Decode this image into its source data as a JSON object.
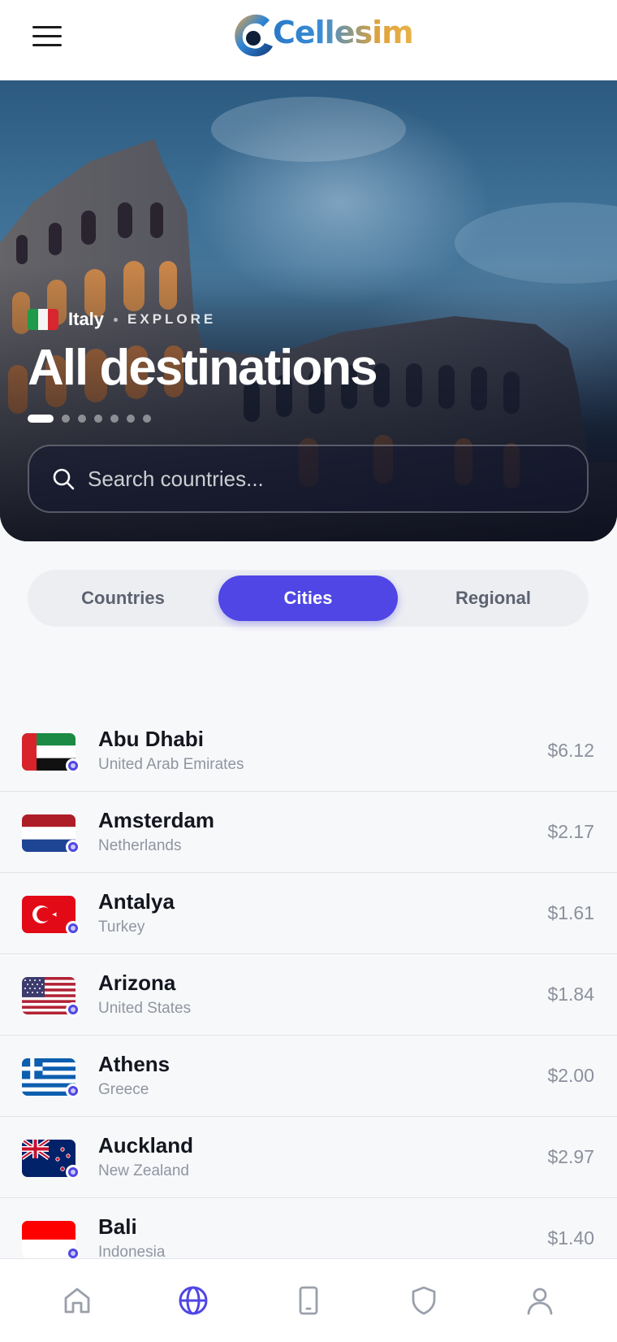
{
  "header": {
    "brand": "Cellesim",
    "menu_icon": "hamburger-menu-icon"
  },
  "hero": {
    "country": "Italy",
    "country_flag": "italy-flag",
    "eyebrow": "EXPLORE",
    "title": "All destinations",
    "slides_total": 7,
    "slide_active_index": 0,
    "background_image": "colosseum-at-dusk"
  },
  "search": {
    "placeholder": "Search countries...",
    "value": "",
    "icon": "search-icon"
  },
  "tabs": [
    {
      "label": "Countries",
      "active": false
    },
    {
      "label": "Cities",
      "active": true
    },
    {
      "label": "Regional",
      "active": false
    }
  ],
  "cities": [
    {
      "name": "Abu Dhabi",
      "country": "United Arab Emirates",
      "price": "$6.12",
      "flag": "uae-flag"
    },
    {
      "name": "Amsterdam",
      "country": "Netherlands",
      "price": "$2.17",
      "flag": "netherlands-flag"
    },
    {
      "name": "Antalya",
      "country": "Turkey",
      "price": "$1.61",
      "flag": "turkey-flag"
    },
    {
      "name": "Arizona",
      "country": "United States",
      "price": "$1.84",
      "flag": "usa-flag"
    },
    {
      "name": "Athens",
      "country": "Greece",
      "price": "$2.00",
      "flag": "greece-flag"
    },
    {
      "name": "Auckland",
      "country": "New Zealand",
      "price": "$2.97",
      "flag": "new-zealand-flag"
    },
    {
      "name": "Bali",
      "country": "Indonesia",
      "price": "$1.40",
      "flag": "indonesia-flag"
    }
  ],
  "bottom_nav": [
    {
      "icon": "home-icon",
      "active": false
    },
    {
      "icon": "globe-icon",
      "active": true
    },
    {
      "icon": "device-icon",
      "active": false
    },
    {
      "icon": "shield-icon",
      "active": false
    },
    {
      "icon": "profile-icon",
      "active": false
    }
  ],
  "colors": {
    "accent": "#4f46e5",
    "inactive_icon": "#9aa0ab",
    "text_primary": "#14161f",
    "text_secondary": "#9095a0"
  }
}
